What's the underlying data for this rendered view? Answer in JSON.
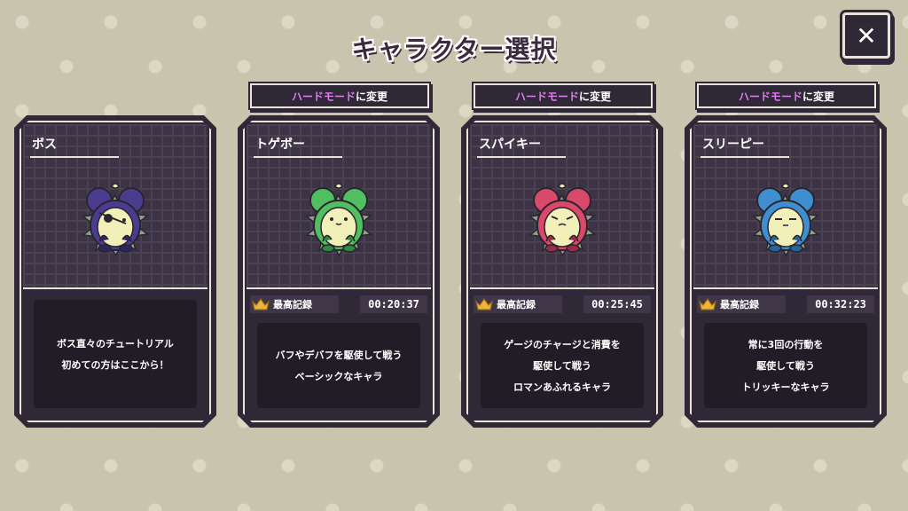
{
  "title": "キャラクター選択",
  "close_label": "✕",
  "hard_mode": {
    "highlight": "ハードモード",
    "suffix": "に変更"
  },
  "record_label": "最高記録",
  "cards": [
    {
      "name": "ボス",
      "color": "#4a3d8f",
      "dark": "#2e2660",
      "desc": [
        "ボス直々のチュートリアル",
        "初めての方はここから！"
      ]
    },
    {
      "name": "トゲボー",
      "color": "#4fbf5f",
      "dark": "#2f8a3e",
      "record": "00:20:37",
      "desc": [
        "バフやデバフを駆使して戦う",
        "ベーシックなキャラ"
      ]
    },
    {
      "name": "スパイキー",
      "color": "#d9496a",
      "dark": "#9c2a48",
      "record": "00:25:45",
      "desc": [
        "ゲージのチャージと消費を",
        "駆使して戦う",
        "ロマンあふれるキャラ"
      ]
    },
    {
      "name": "スリーピー",
      "color": "#3f8fd0",
      "dark": "#286399",
      "record": "00:32:23",
      "desc": [
        "常に3回の行動を",
        "駆使して戦う",
        "トリッキーなキャラ"
      ]
    }
  ]
}
